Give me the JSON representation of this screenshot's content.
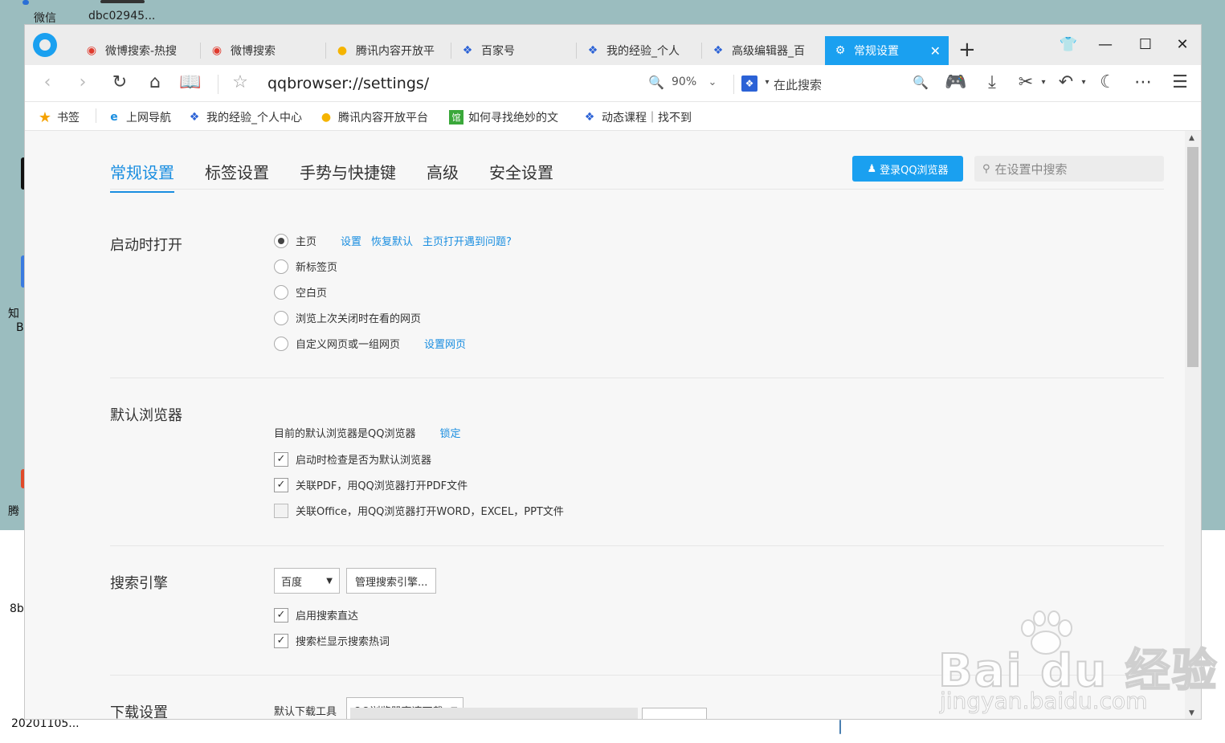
{
  "desktop": {
    "labels": [
      "微信",
      "dbc02945...",
      "知",
      "B",
      "腾",
      "8b",
      "20201105..."
    ]
  },
  "tabs": [
    {
      "label": "微博搜索-热搜",
      "icon": "weibo-icon",
      "active": false
    },
    {
      "label": "微博搜索",
      "icon": "weibo-icon",
      "active": false
    },
    {
      "label": "腾讯内容开放平",
      "icon": "tencent-bell-icon",
      "active": false
    },
    {
      "label": "百家号",
      "icon": "baidu-paw-icon",
      "active": false
    },
    {
      "label": "我的经验_个人",
      "icon": "baidu-paw-icon",
      "active": false
    },
    {
      "label": "高级编辑器_百",
      "icon": "baidu-paw-icon",
      "active": false
    },
    {
      "label": "常规设置",
      "icon": "settings-gear-icon",
      "active": true
    }
  ],
  "toolbar": {
    "url": "qqbrowser://settings/",
    "zoom": "90%",
    "search_placeholder": "在此搜索"
  },
  "bookmarks": [
    {
      "label": "书签",
      "icon": "star-icon"
    },
    {
      "label": "上网导航",
      "icon": "ie-icon"
    },
    {
      "label": "我的经验_个人中心",
      "icon": "baidu-paw-icon"
    },
    {
      "label": "腾讯内容开放平台",
      "icon": "tencent-bell-icon"
    },
    {
      "label": "如何寻找绝妙的文",
      "icon": "library-icon"
    },
    {
      "label": "动态课程｜找不到",
      "icon": "baidu-paw-icon"
    }
  ],
  "settings": {
    "tabs": [
      "常规设置",
      "标签设置",
      "手势与快捷键",
      "高级",
      "安全设置"
    ],
    "login_button": "登录QQ浏览器",
    "search_placeholder": "在设置中搜索",
    "startup": {
      "title": "启动时打开",
      "options": [
        "主页",
        "新标签页",
        "空白页",
        "浏览上次关闭时在看的网页",
        "自定义网页或一组网页"
      ],
      "selected_index": 0,
      "homepage_links": [
        "设置",
        "恢复默认",
        "主页打开遇到问题?"
      ],
      "custom_link": "设置网页"
    },
    "default_browser": {
      "title": "默认浏览器",
      "status": "目前的默认浏览器是QQ浏览器",
      "lock_link": "锁定",
      "checks": [
        {
          "label": "启动时检查是否为默认浏览器",
          "checked": true
        },
        {
          "label": "关联PDF，用QQ浏览器打开PDF文件",
          "checked": true
        },
        {
          "label": "关联Office，用QQ浏览器打开WORD，EXCEL，PPT文件",
          "checked": false
        }
      ]
    },
    "search_engine": {
      "title": "搜索引擎",
      "selected": "百度",
      "manage_button": "管理搜索引擎...",
      "checks": [
        {
          "label": "启用搜索直达",
          "checked": true
        },
        {
          "label": "搜索栏显示搜索热词",
          "checked": true
        }
      ]
    },
    "download": {
      "title": "下载设置",
      "tool_label": "默认下载工具",
      "tool_selected": "QQ浏览器高速下载"
    }
  },
  "watermark": {
    "line1": "Bai du 经验",
    "line2": "jingyan.baidu.com"
  },
  "colors": {
    "accent": "#1aa0f0",
    "link": "#1a8ee0",
    "desktop": "#9bbdbf"
  }
}
